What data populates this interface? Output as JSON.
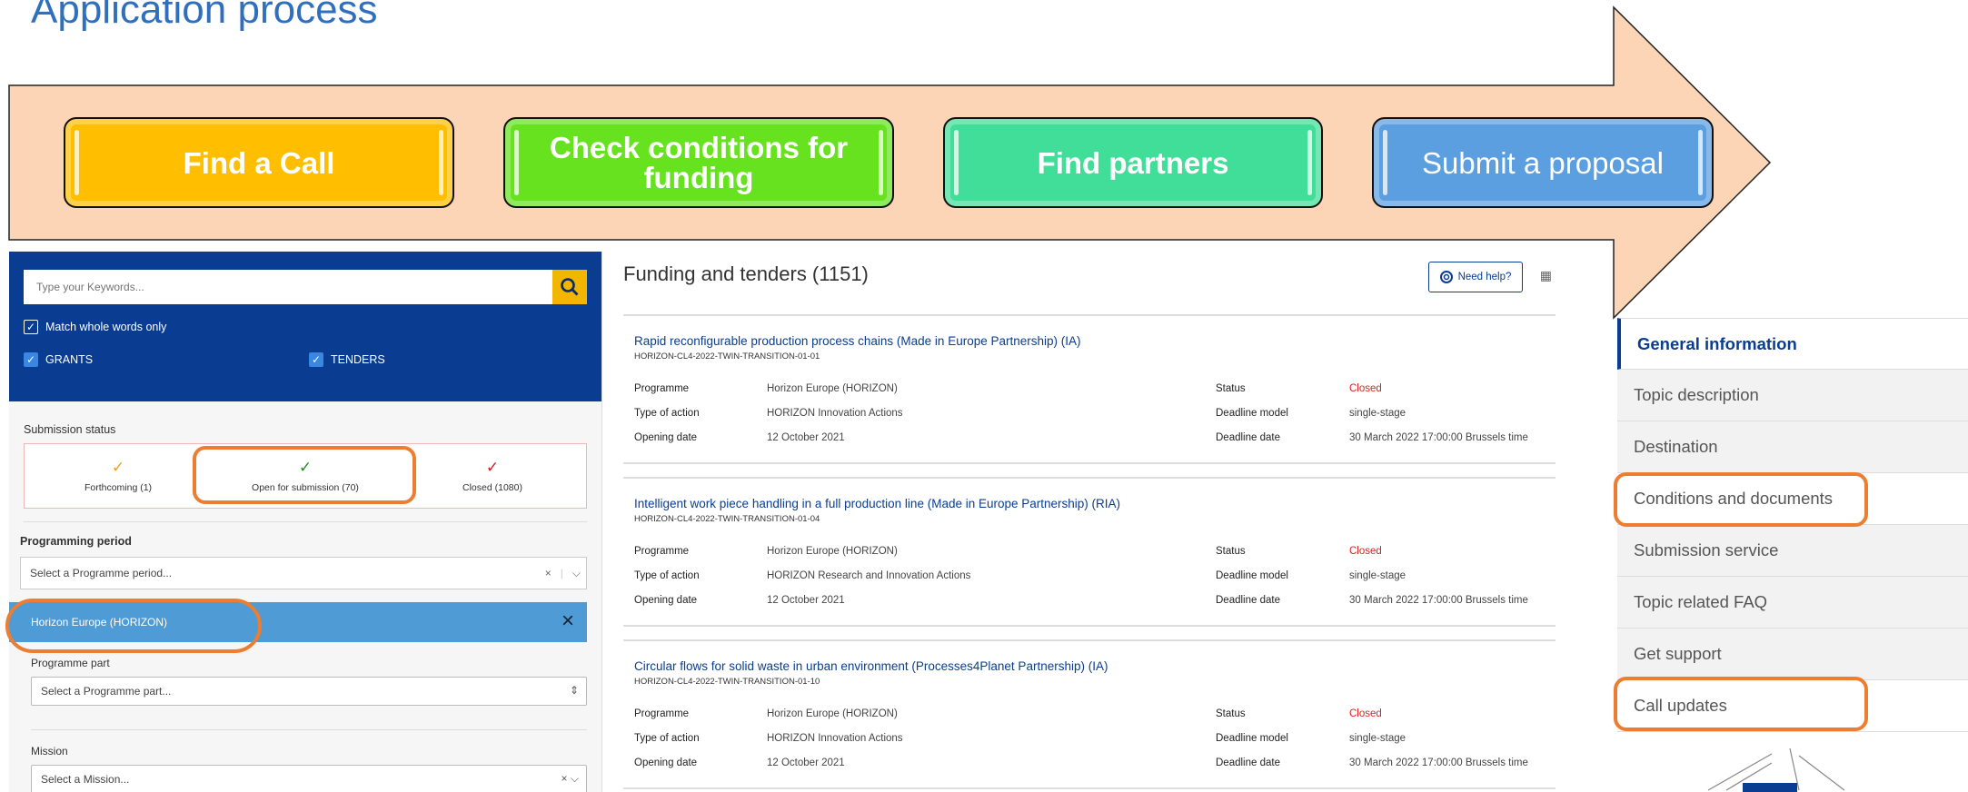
{
  "title": "Application process",
  "steps": [
    {
      "label": "Find a Call",
      "color": "#ffbf00"
    },
    {
      "label": "Check conditions for funding",
      "color": "#66e21f"
    },
    {
      "label": "Find partners",
      "color": "#40de98"
    },
    {
      "label": "Submit a proposal",
      "color": "#5b9fe0"
    }
  ],
  "filters": {
    "search_placeholder": "Type your Keywords...",
    "match_whole_words": "Match whole words only",
    "grants": "GRANTS",
    "tenders": "TENDERS",
    "submission_status_label": "Submission status",
    "statuses": [
      {
        "label": "Forthcoming (1)",
        "mark": "✓",
        "color": "#f0a020"
      },
      {
        "label": "Open for submission (70)",
        "mark": "✓",
        "color": "#2a8a2a"
      },
      {
        "label": "Closed (1080)",
        "mark": "✓",
        "color": "#d22020"
      }
    ],
    "programming_period_label": "Programming period",
    "programme_period_placeholder": "Select a Programme period...",
    "selected_programme": "Horizon Europe (HORIZON)",
    "programme_part_label": "Programme part",
    "programme_part_placeholder": "Select a Programme part...",
    "mission_label": "Mission",
    "mission_placeholder": "Select a Mission..."
  },
  "results": {
    "heading": "Funding and tenders (1151)",
    "help_label": "Need help?",
    "field_labels": {
      "programme": "Programme",
      "type_of_action": "Type of action",
      "opening_date": "Opening date",
      "status": "Status",
      "deadline_model": "Deadline model",
      "deadline_date": "Deadline date"
    },
    "cards": [
      {
        "title": "Rapid reconfigurable production process chains (Made in Europe Partnership) (IA)",
        "id": "HORIZON-CL4-2022-TWIN-TRANSITION-01-01",
        "programme": "Horizon Europe (HORIZON)",
        "type_of_action": "HORIZON Innovation Actions",
        "opening_date": "12 October 2021",
        "status": "Closed",
        "deadline_model": "single-stage",
        "deadline_date": "30 March 2022 17:00:00 Brussels time"
      },
      {
        "title": "Intelligent work piece handling in a full production line (Made in Europe Partnership) (RIA)",
        "id": "HORIZON-CL4-2022-TWIN-TRANSITION-01-04",
        "programme": "Horizon Europe (HORIZON)",
        "type_of_action": "HORIZON Research and Innovation Actions",
        "opening_date": "12 October 2021",
        "status": "Closed",
        "deadline_model": "single-stage",
        "deadline_date": "30 March 2022 17:00:00 Brussels time"
      },
      {
        "title": "Circular flows for solid waste in urban environment (Processes4Planet Partnership) (IA)",
        "id": "HORIZON-CL4-2022-TWIN-TRANSITION-01-10",
        "programme": "Horizon Europe (HORIZON)",
        "type_of_action": "HORIZON Innovation Actions",
        "opening_date": "12 October 2021",
        "status": "Closed",
        "deadline_model": "single-stage",
        "deadline_date": "30 March 2022 17:00:00 Brussels time"
      }
    ]
  },
  "side_nav": [
    "General information",
    "Topic description",
    "Destination",
    "Conditions and documents",
    "Submission service",
    "Topic related FAQ",
    "Get support",
    "Call updates"
  ],
  "colors": {
    "arrow_fill": "#fbd5b5",
    "highlight": "#ed7d31",
    "eu_blue": "#0a3d91"
  }
}
